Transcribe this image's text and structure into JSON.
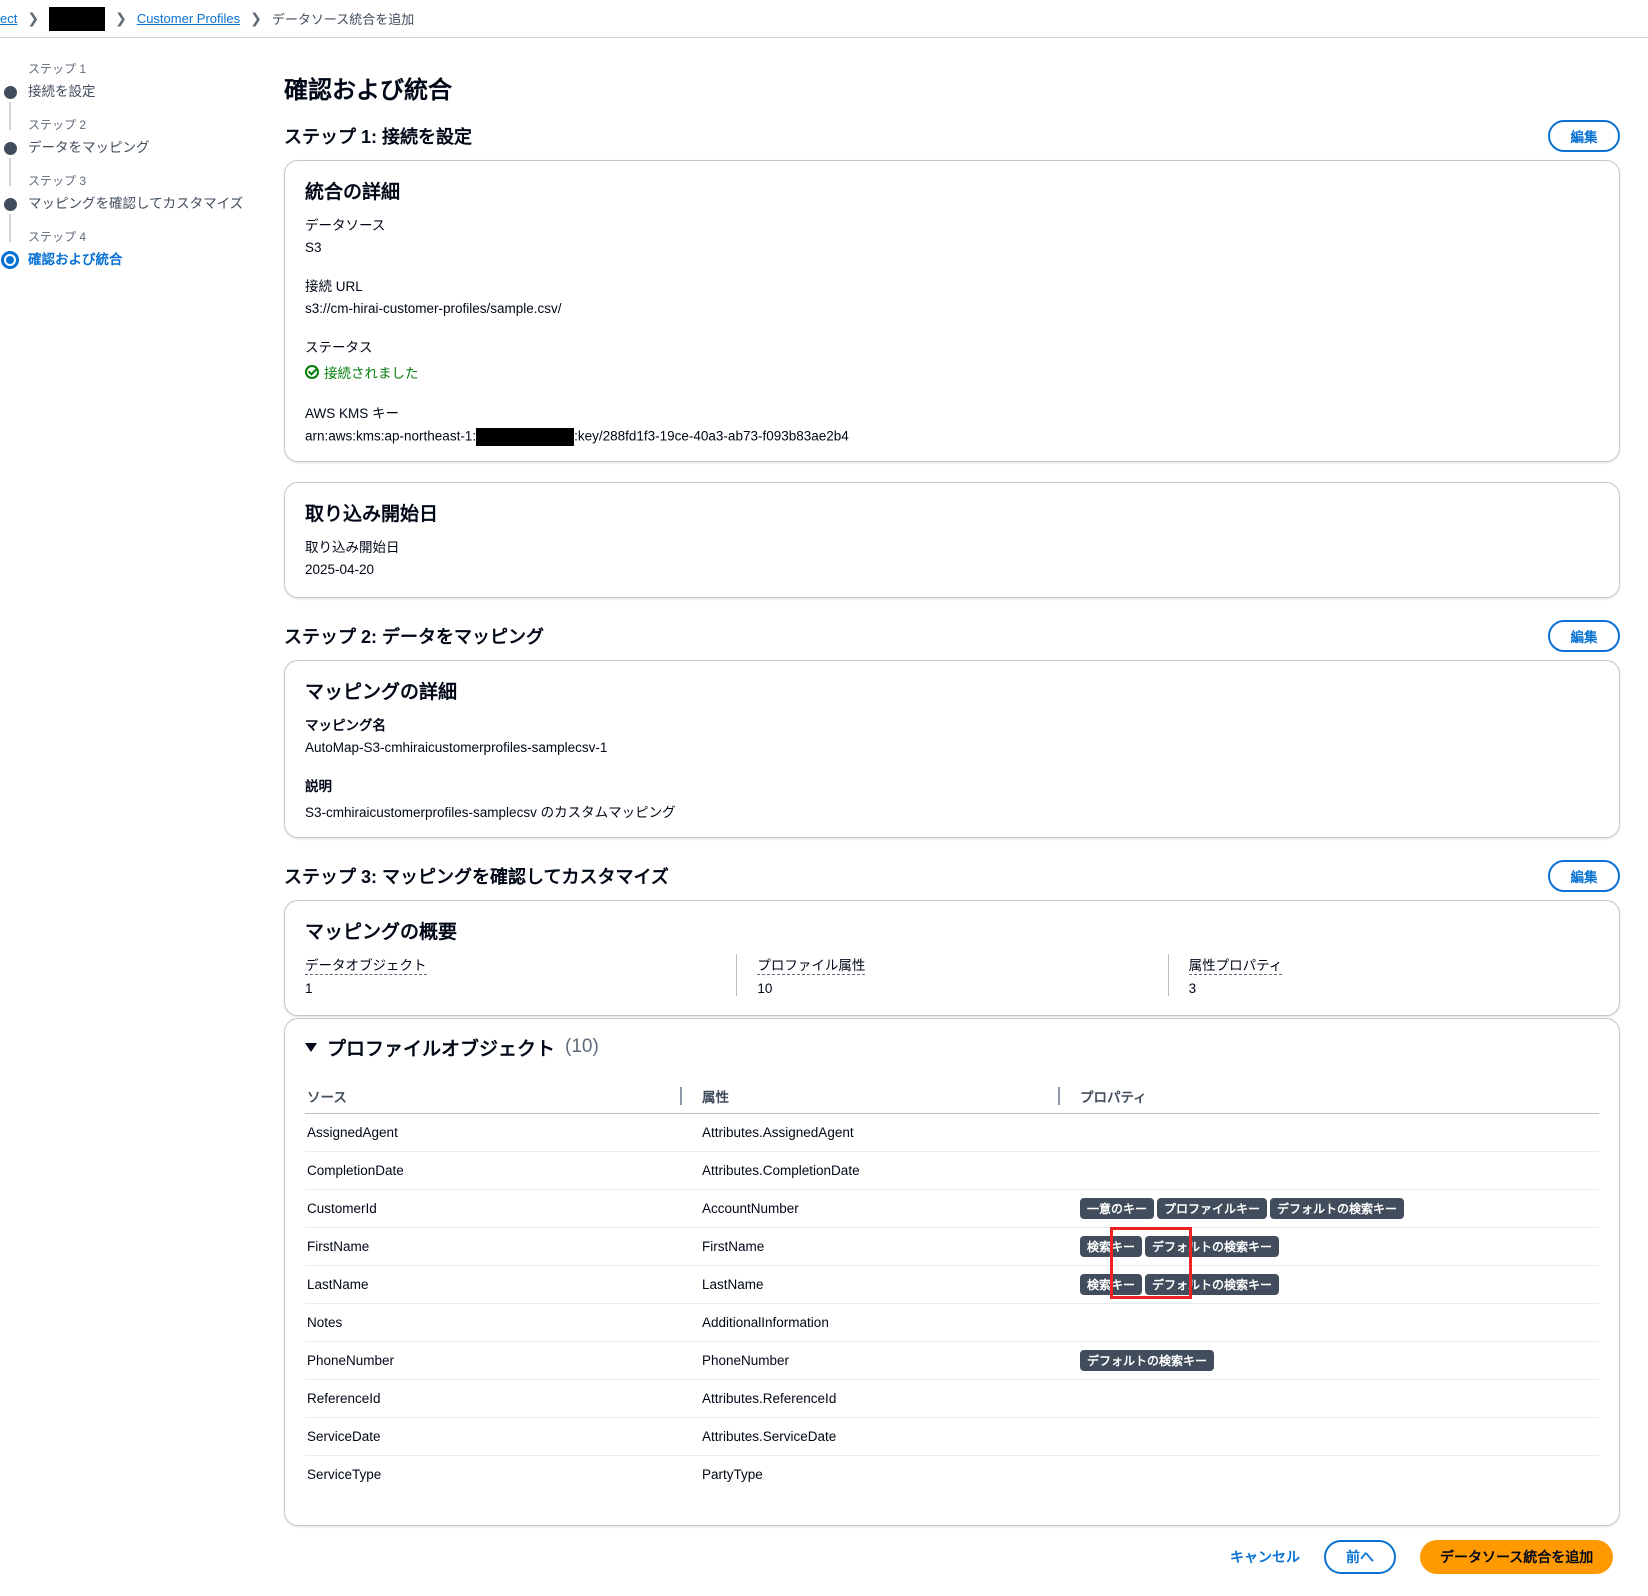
{
  "breadcrumb": {
    "first": "ect",
    "second": "Customer Profiles",
    "current": "データソース統合を追加"
  },
  "steps": [
    {
      "num": "ステップ 1",
      "label": "接続を設定"
    },
    {
      "num": "ステップ 2",
      "label": "データをマッピング"
    },
    {
      "num": "ステップ 3",
      "label": "マッピングを確認してカスタマイズ"
    },
    {
      "num": "ステップ 4",
      "label": "確認および統合"
    }
  ],
  "page_title": "確認および統合",
  "edit_label": "編集",
  "section1": {
    "title": "ステップ 1: 接続を設定",
    "card1": {
      "title": "統合の詳細",
      "datasource_label": "データソース",
      "datasource_value": "S3",
      "url_label": "接続 URL",
      "url_value": "s3://cm-hirai-customer-profiles/sample.csv/",
      "status_label": "ステータス",
      "status_value": "接続されました",
      "kms_label": "AWS KMS キー",
      "kms_prefix": "arn:aws:kms:ap-northeast-1:",
      "kms_suffix": ":key/288fd1f3-19ce-40a3-ab73-f093b83ae2b4"
    },
    "card2": {
      "title": "取り込み開始日",
      "label": "取り込み開始日",
      "value": "2025-04-20"
    }
  },
  "section2": {
    "title": "ステップ 2: データをマッピング",
    "card": {
      "title": "マッピングの詳細",
      "name_label": "マッピング名",
      "name_value": "AutoMap-S3-cmhiraicustomerprofiles-samplecsv-1",
      "desc_label": "説明",
      "desc_value": "S3-cmhiraicustomerprofiles-samplecsv のカスタムマッピング"
    }
  },
  "section3": {
    "title": "ステップ 3: マッピングを確認してカスタマイズ",
    "summary": {
      "title": "マッピングの概要",
      "items": [
        {
          "label": "データオブジェクト",
          "value": "1"
        },
        {
          "label": "プロファイル属性",
          "value": "10"
        },
        {
          "label": "属性プロパティ",
          "value": "3"
        }
      ]
    },
    "profile_objects": {
      "title": "プロファイルオブジェクト",
      "count": "(10)",
      "columns": [
        "ソース",
        "属性",
        "プロパティ"
      ],
      "rows": [
        {
          "source": "AssignedAgent",
          "attr": "Attributes.AssignedAgent",
          "badges": []
        },
        {
          "source": "CompletionDate",
          "attr": "Attributes.CompletionDate",
          "badges": []
        },
        {
          "source": "CustomerId",
          "attr": "AccountNumber",
          "badges": [
            "一意のキー",
            "プロファイルキー",
            "デフォルトの検索キー"
          ]
        },
        {
          "source": "FirstName",
          "attr": "FirstName",
          "badges": [
            "検索キー",
            "デフォルトの検索キー"
          ]
        },
        {
          "source": "LastName",
          "attr": "LastName",
          "badges": [
            "検索キー",
            "デフォルトの検索キー"
          ]
        },
        {
          "source": "Notes",
          "attr": "AdditionalInformation",
          "badges": []
        },
        {
          "source": "PhoneNumber",
          "attr": "PhoneNumber",
          "badges": [
            "デフォルトの検索キー"
          ]
        },
        {
          "source": "ReferenceId",
          "attr": "Attributes.ReferenceId",
          "badges": []
        },
        {
          "source": "ServiceDate",
          "attr": "Attributes.ServiceDate",
          "badges": []
        },
        {
          "source": "ServiceType",
          "attr": "PartyType",
          "badges": []
        }
      ]
    }
  },
  "footer": {
    "cancel": "キャンセル",
    "previous": "前へ",
    "submit": "データソース統合を追加"
  }
}
